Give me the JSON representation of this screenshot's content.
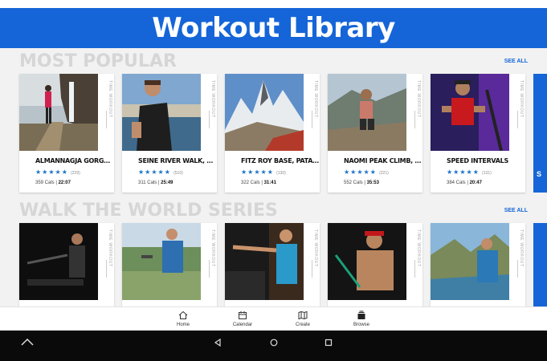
{
  "header": {
    "title": "Workout Library"
  },
  "sections": [
    {
      "title": "MOST POPULAR",
      "see_all": "SEE ALL",
      "cards": [
        {
          "title": "ALMANNAGJA GORGE RUN, ICEL...",
          "stars": "★★★★★",
          "count": "(229)",
          "cals": "359 Cals |",
          "time": "22:07",
          "side": "TIME WORKOUT"
        },
        {
          "title": "SEINE RIVER WALK, FRANCE",
          "stars": "★★★★★",
          "count": "(510)",
          "cals": "311 Cals |",
          "time": "25:49",
          "side": "TIME WORKOUT"
        },
        {
          "title": "FITZ ROY BASE, PATAGONIA, A...",
          "stars": "★★★★★",
          "count": "(130)",
          "cals": "322 Cals |",
          "time": "31:41",
          "side": "TIME WORKOUT"
        },
        {
          "title": "NAOMI PEAK CLIMB, LOGAN C...",
          "stars": "★★★★★",
          "count": "(221)",
          "cals": "552 Cals |",
          "time": "35:53",
          "side": "TIME WORKOUT"
        },
        {
          "title": "SPEED INTERVALS",
          "stars": "★★★★★",
          "count": "(131)",
          "cals": "384 Cals |",
          "time": "20:47",
          "side": "TIME WORKOUT"
        }
      ],
      "peek_letter": "S"
    },
    {
      "title": "WALK THE WORLD SERIES",
      "see_all": "SEE ALL",
      "cards": [
        {
          "side": "TIME WORKOUT"
        },
        {
          "side": "TIME WORKOUT"
        },
        {
          "side": "TIME WORKOUT"
        },
        {
          "side": "TIME WORKOUT"
        },
        {
          "side": "TIME WORKOUT"
        }
      ]
    }
  ],
  "bottom_nav": [
    {
      "label": "Home",
      "icon": "home-icon"
    },
    {
      "label": "Calendar",
      "icon": "calendar-icon"
    },
    {
      "label": "Create",
      "icon": "map-icon"
    },
    {
      "label": "Browse",
      "icon": "browse-icon"
    }
  ],
  "colors": {
    "brand": "#1565d8",
    "star": "#1a73c8",
    "section_title": "#d6d6d6"
  }
}
